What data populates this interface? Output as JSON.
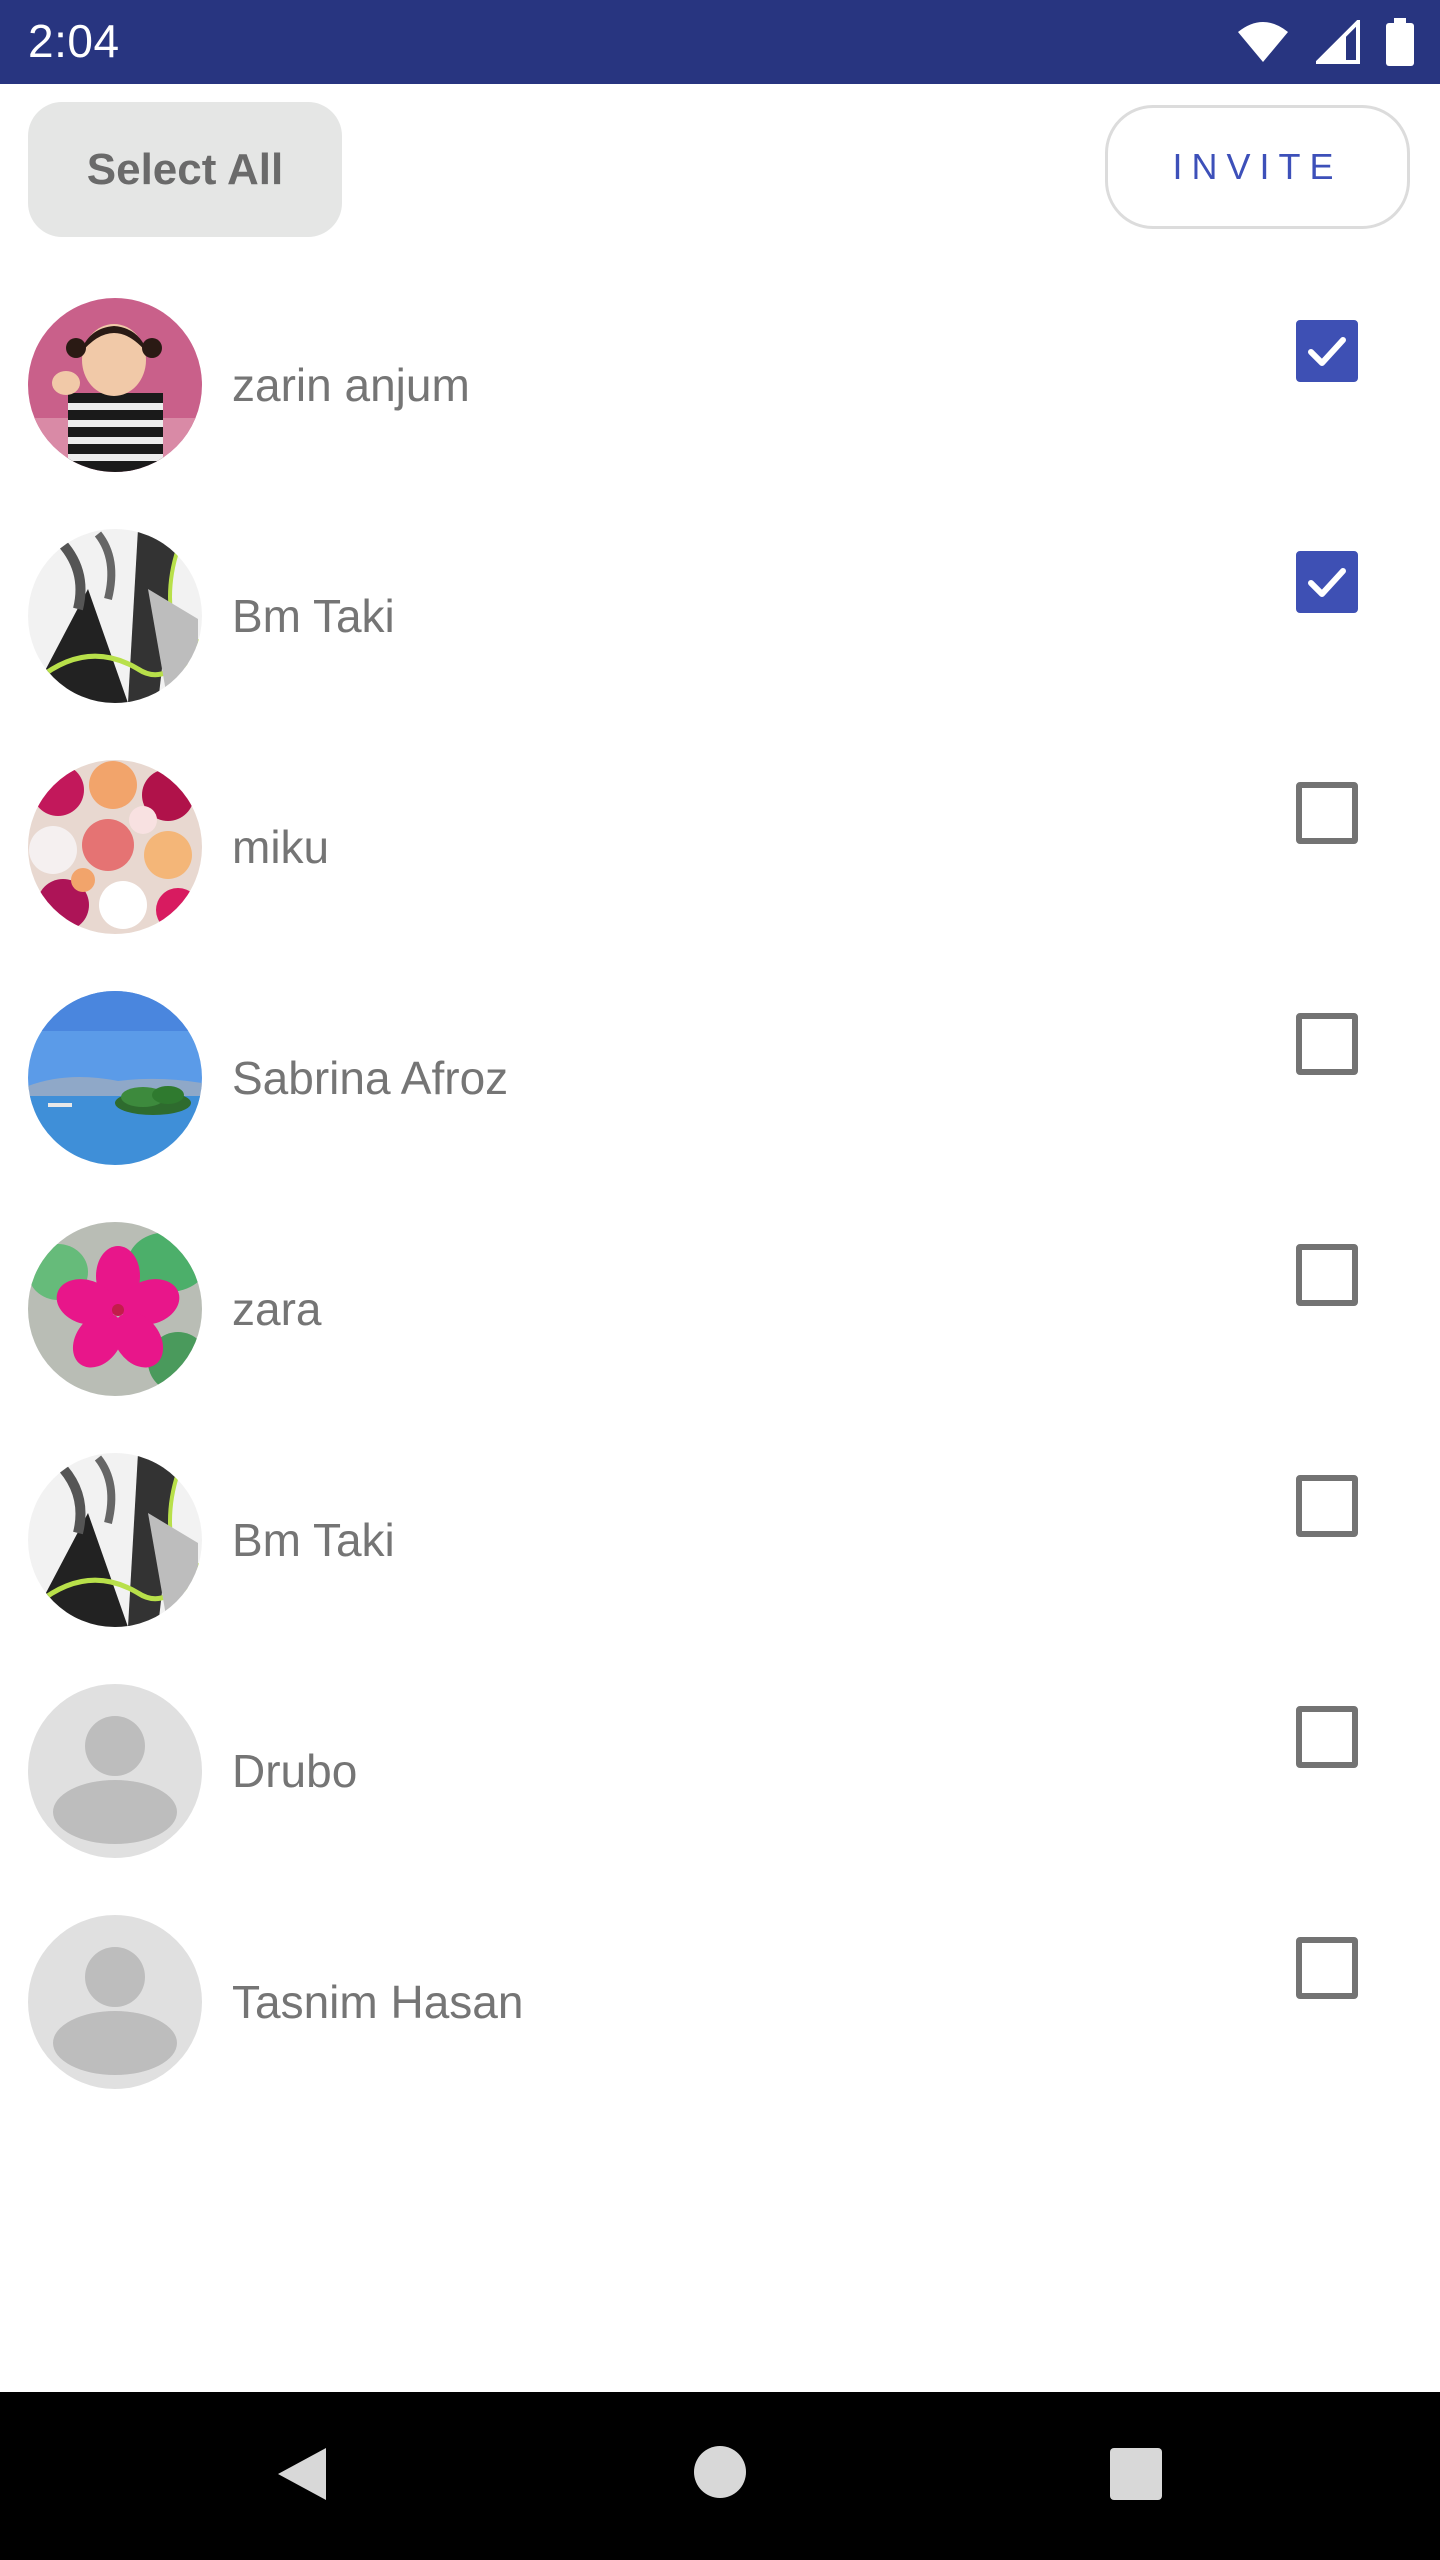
{
  "status_bar": {
    "time": "2:04",
    "icons": [
      "wifi-icon",
      "signal-icon",
      "battery-icon"
    ]
  },
  "toolbar": {
    "select_all_label": "Select All",
    "invite_label": "INVITE"
  },
  "contacts": [
    {
      "name": "zarin anjum",
      "checked": true,
      "avatar": "photo-child"
    },
    {
      "name": "Bm Taki",
      "checked": true,
      "avatar": "photo-abstract"
    },
    {
      "name": "miku",
      "checked": false,
      "avatar": "photo-flowers"
    },
    {
      "name": "Sabrina Afroz",
      "checked": false,
      "avatar": "photo-lake"
    },
    {
      "name": "zara",
      "checked": false,
      "avatar": "photo-pink-flower"
    },
    {
      "name": "Bm Taki",
      "checked": false,
      "avatar": "photo-abstract"
    },
    {
      "name": "Drubo",
      "checked": false,
      "avatar": "default-person-icon"
    },
    {
      "name": "Tasnim Hasan",
      "checked": false,
      "avatar": "default-person-icon"
    }
  ],
  "colors": {
    "status_bar": "#283580",
    "accent": "#3e50b4",
    "checkbox_unchecked": "#737373",
    "name_text": "#757575",
    "select_all_bg": "#e5e6e5"
  },
  "nav_bar": {
    "icons": [
      "back-icon",
      "home-icon",
      "recents-icon"
    ]
  }
}
